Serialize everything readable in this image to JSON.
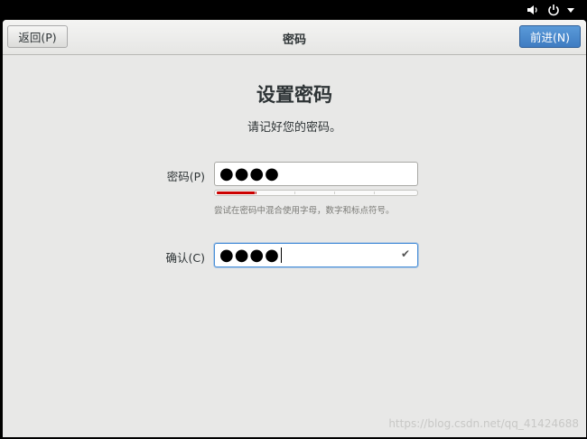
{
  "system": {
    "volume_icon": "volume-icon",
    "power_icon": "power-icon",
    "menu_icon": "menu-arrow-icon"
  },
  "header": {
    "back_label": "返回(P)",
    "title": "密码",
    "next_label": "前进(N)"
  },
  "main": {
    "title": "设置密码",
    "subtitle": "请记好您的密码。",
    "password_label": "密码(P)",
    "password_value": "●●●●",
    "strength_level": 0.2,
    "hint": "尝试在密码中混合使用字母，数字和标点符号。",
    "confirm_label": "确认(C)",
    "confirm_value": "●●●●",
    "confirm_icon": "check-icon"
  },
  "watermark": "https://blog.csdn.net/qq_41424688",
  "colors": {
    "accent": "#4a90d9",
    "strength_weak": "#cc0000",
    "background": "#e8e8e7"
  }
}
